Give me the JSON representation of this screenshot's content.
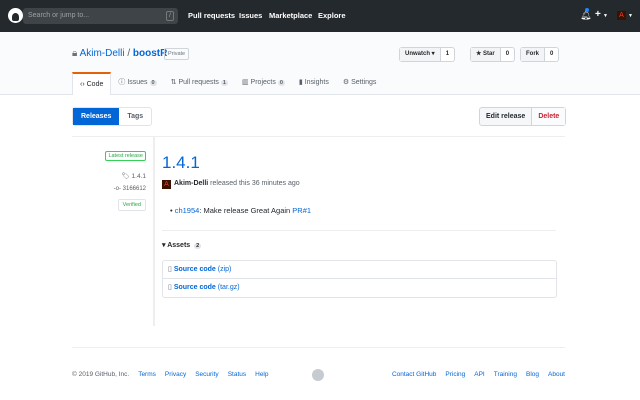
{
  "header": {
    "search_placeholder": "Search or jump to...",
    "slash": "/",
    "nav": [
      "Pull requests",
      "Issues",
      "Marketplace",
      "Explore"
    ],
    "plus": "+",
    "avatar": "A"
  },
  "repo": {
    "owner": "Akim-Delli",
    "sep": " / ",
    "name": "boostR",
    "visibility": "Private",
    "watch": {
      "label": "Unwatch ▾",
      "count": "1"
    },
    "star": {
      "label": "★ Star",
      "count": "0"
    },
    "fork": {
      "label": "Fork",
      "count": "0"
    },
    "tabs": [
      {
        "label": "Code",
        "icon": "‹›"
      },
      {
        "label": "Issues",
        "count": "0",
        "icon": "ⓘ"
      },
      {
        "label": "Pull requests",
        "count": "1",
        "icon": "⇅"
      },
      {
        "label": "Projects",
        "count": "0",
        "icon": "▥"
      },
      {
        "label": "Insights",
        "icon": "▮"
      },
      {
        "label": "Settings",
        "icon": "⚙"
      }
    ]
  },
  "subnav": {
    "releases": "Releases",
    "tags": "Tags",
    "edit": "Edit release",
    "delete": "Delete"
  },
  "release": {
    "latest": "Latest release",
    "tag": "1.4.1",
    "commit": "3166612",
    "verified": "Verified",
    "title": "1.4.1",
    "author": "Akim-Delli",
    "released": " released this 36 minutes ago",
    "note": {
      "user": "ch1954",
      "text": ": Make release Great Again ",
      "pr": "PR#1"
    },
    "assets_label": "Assets",
    "assets_count": "2",
    "assets": [
      {
        "name": "Source code",
        "type": "(zip)"
      },
      {
        "name": "Source code",
        "type": "(tar.gz)"
      }
    ]
  },
  "footer": {
    "copyright": "© 2019 GitHub, Inc.",
    "left": [
      "Terms",
      "Privacy",
      "Security",
      "Status",
      "Help"
    ],
    "right": [
      "Contact GitHub",
      "Pricing",
      "API",
      "Training",
      "Blog",
      "About"
    ]
  }
}
